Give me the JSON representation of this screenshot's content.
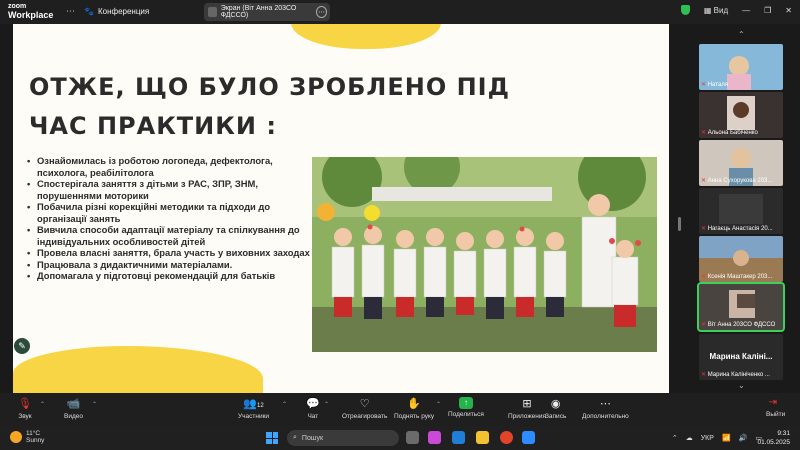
{
  "topbar": {
    "logo_line1": "zoom",
    "logo_line2": "Workplace",
    "conference_label": "Конференция",
    "screen_share_label": "Экран (Віт Анна 203СО ФДССО)",
    "view_label": "Вид"
  },
  "slide": {
    "title": "ОТЖЕ, ЩО БУЛО ЗРОБЛЕНО ПІД ЧАС ПРАКТИКИ :",
    "bullets": [
      "Ознайомилась із роботою логопеда, дефектолога, психолога, реабілітолога",
      "Спостерігала заняття з дітьми з РАС, ЗПР, ЗНМ, порушеннями моторики",
      "Побачила різні корекційні методики та підходи до організації занять",
      "Вивчила способи адаптації матеріалу та спілкування до індивідуальних особливостей дітей",
      "Провела власні заняття, брала участь у виховних заходах",
      "Працювала з дидактичними матеріалами.",
      "Допомагала у підготовці рекомендацій для батьків"
    ]
  },
  "gallery": {
    "participants": [
      {
        "name": "Наталя",
        "muted": true
      },
      {
        "name": "Альона Бабіченко",
        "muted": true
      },
      {
        "name": "Анна Сухорукова 203...",
        "muted": true
      },
      {
        "name": "Нагаєць Анастасія 20...",
        "muted": true
      },
      {
        "name": "Ксенія Маштакер 203...",
        "muted": true
      },
      {
        "name": "Віт Анна 203СО ФДССО",
        "muted": true
      },
      {
        "name": "Марина Калініченко ...",
        "muted": true,
        "display_name": "Марина  Калінi..."
      }
    ]
  },
  "toolbar": {
    "audio": "Звук",
    "video": "Видео",
    "participants_count": "12",
    "participants": "Участники",
    "chat": "Чат",
    "reactions": "Отреагировать",
    "raise_hand": "Поднять руку",
    "share": "Поделиться",
    "apps": "Приложения",
    "record": "Запись",
    "more": "Дополнительно",
    "leave": "Выйти"
  },
  "taskbar": {
    "temperature": "11°C",
    "weather": "Sunny",
    "search_placeholder": "Пошук",
    "language": "УКР",
    "time": "9:31",
    "date": "01.05.2025"
  },
  "colors": {
    "slide_bg": "#fefcf7",
    "accent_yellow": "#f7d33a",
    "active_speaker": "#3cd15a",
    "muted_red": "#e33333",
    "share_green": "#25b34b"
  }
}
